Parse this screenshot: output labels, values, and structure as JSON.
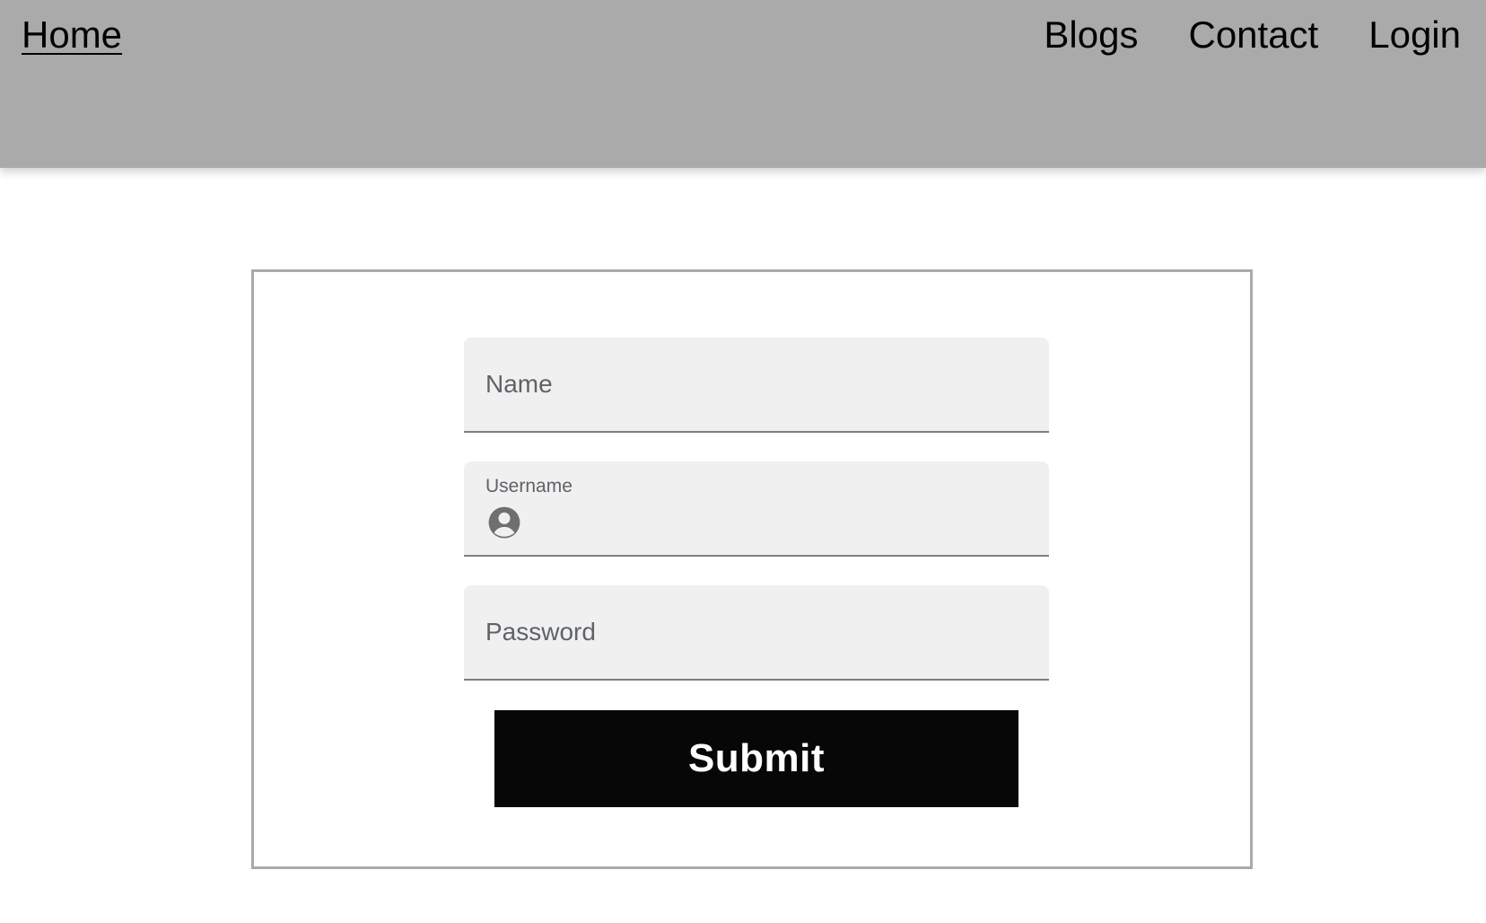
{
  "nav": {
    "home_label": "Home",
    "links": [
      {
        "label": "Blogs"
      },
      {
        "label": "Contact"
      },
      {
        "label": "Login"
      }
    ]
  },
  "form": {
    "name_field": {
      "placeholder": "Name",
      "value": ""
    },
    "username_field": {
      "label": "Username",
      "icon": "account-circle-icon",
      "value": ""
    },
    "password_field": {
      "placeholder": "Password",
      "value": ""
    },
    "submit_label": "Submit"
  },
  "colors": {
    "header_background": "#aaaaaa",
    "field_background": "#f0f0f0",
    "card_border": "#aaaaaa",
    "button_background": "#070707",
    "button_text": "#ffffff",
    "placeholder_text": "#5f6368"
  }
}
